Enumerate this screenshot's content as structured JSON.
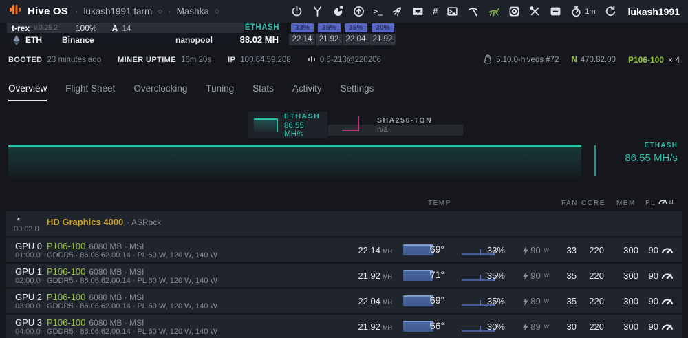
{
  "topbar": {
    "brand": "Hive OS",
    "sep": "·",
    "farm_name": "lukash1991 farm",
    "worker_name": "Mashka",
    "sort_caret": "◇",
    "hash_glyph": "#",
    "prompt_glyph": ">_",
    "timer_value": "1m",
    "username": "lukash1991",
    "icons": [
      "power-icon",
      "fork-icon",
      "pie-lock-icon",
      "upgrade-icon",
      "terminal-prompt-icon",
      "rocket-icon",
      "rig-icon",
      "hash-icon",
      "shell-icon",
      "pickaxe-icon",
      "grasshopper-icon",
      "fan-icon",
      "tools-icon",
      "minus-box-icon",
      "timer-icon",
      "refresh-icon"
    ]
  },
  "miner_bar": {
    "miner_name": "t-rex",
    "miner_version": "v.0.25.2",
    "load": "100%",
    "accepted_label": "A",
    "accepted_count": "14",
    "algo": "ETHASH",
    "total_hashrate": "88.02 MH",
    "fan_speeds": [
      "33%",
      "35%",
      "35%",
      "30%"
    ],
    "gpu_hashrates": [
      "22.14",
      "21.92",
      "22.04",
      "21.92"
    ],
    "coin": "ETH",
    "wallet": "Binance",
    "pool": "nanopool"
  },
  "status_bar": {
    "booted_label": "BOOTED",
    "booted_value": "23 minutes ago",
    "uptime_label": "MINER UPTIME",
    "uptime_value": "16m 20s",
    "ip_label": "IP",
    "ip_value": "100.64.59.208",
    "agent_version": "0.6-213@220206",
    "kernel_version": "5.10.0-hiveos #72",
    "nvidia_label": "N",
    "nvidia_driver": "470.82.00",
    "gpu_model": "P106-100",
    "gpu_count": "× 4"
  },
  "tabs": {
    "items": [
      "Overview",
      "Flight Sheet",
      "Overclocking",
      "Tuning",
      "Stats",
      "Activity",
      "Settings"
    ],
    "active": "Overview"
  },
  "widgets": {
    "ethash": {
      "label": "ETHASH",
      "value": "86.55 MH/s"
    },
    "sha": {
      "label": "SHA256-TON",
      "value": "n/a"
    }
  },
  "chart": {
    "label": "ETHASH",
    "value": "86.55 MH/s"
  },
  "table": {
    "headers": {
      "temp": "TEMP",
      "fan": "FAN",
      "core": "CORE",
      "mem": "MEM",
      "pl": "PL",
      "all": "all"
    },
    "unit_mh": "MH",
    "unit_w": "w",
    "rows": [
      {
        "id": "*",
        "bus": "00:02.0",
        "name": "HD Graphics 4000",
        "vendor": "· ASRock"
      },
      {
        "id": "GPU 0",
        "bus": "01:00.0",
        "model": "P106-100",
        "specs": "6080 MB · MSI",
        "details": "GDDR5 · 86.06.62.00.14 · PL 60 W, 120 W, 140 W",
        "hashrate": "22.14",
        "temp": "69°",
        "fan": "33%",
        "power": "90",
        "oc_fan": "33",
        "oc_core": "220",
        "oc_mem": "300",
        "oc_pl": "90"
      },
      {
        "id": "GPU 1",
        "bus": "02:00.0",
        "model": "P106-100",
        "specs": "6080 MB · MSI",
        "details": "GDDR5 · 86.06.62.00.14 · PL 60 W, 120 W, 140 W",
        "hashrate": "21.92",
        "temp": "71°",
        "fan": "35%",
        "power": "90",
        "oc_fan": "35",
        "oc_core": "220",
        "oc_mem": "300",
        "oc_pl": "90"
      },
      {
        "id": "GPU 2",
        "bus": "03:00.0",
        "model": "P106-100",
        "specs": "6080 MB · MSI",
        "details": "GDDR5 · 86.06.62.00.14 · PL 60 W, 120 W, 140 W",
        "hashrate": "22.04",
        "temp": "69°",
        "fan": "35%",
        "power": "89",
        "oc_fan": "35",
        "oc_core": "220",
        "oc_mem": "300",
        "oc_pl": "90"
      },
      {
        "id": "GPU 3",
        "bus": "04:00.0",
        "model": "P106-100",
        "specs": "6080 MB · MSI",
        "details": "GDDR5 · 86.06.62.00.14 · PL 60 W, 120 W, 140 W",
        "hashrate": "21.92",
        "temp": "66°",
        "fan": "30%",
        "power": "89",
        "oc_fan": "30",
        "oc_core": "220",
        "oc_mem": "300",
        "oc_pl": "90"
      }
    ]
  },
  "colors": {
    "accent_teal": "#2dbfa9",
    "accent_green": "#94c13d",
    "accent_yellow": "#c7a02e",
    "badge_blue": "#5766c2",
    "bar_blue": "#48659e",
    "magenta": "#b83577"
  }
}
